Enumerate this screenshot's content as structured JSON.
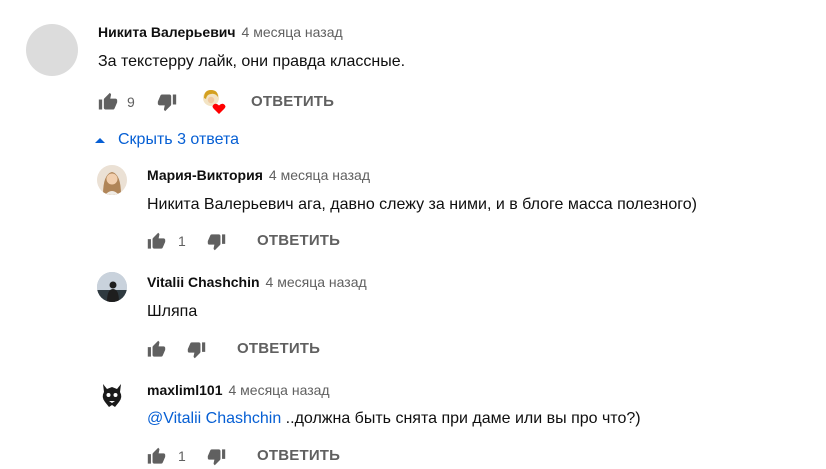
{
  "comments": {
    "main": {
      "author": "Никита Валерьевич",
      "time": "4 месяца назад",
      "text": "За текстерру лайк, они правда классные.",
      "likes": "9",
      "reply_label": "ОТВЕТИТЬ"
    },
    "toggle_label": "Скрыть 3 ответа",
    "replies": [
      {
        "author": "Мария-Виктория",
        "time": "4 месяца назад",
        "text": "Никита Валерьевич ага, давно слежу за ними, и в блоге масса полезного)",
        "likes": "1",
        "reply_label": "ОТВЕТИТЬ"
      },
      {
        "author": "Vitalii Chashchin",
        "time": "4 месяца назад",
        "text": "Шляпа",
        "likes": "",
        "reply_label": "ОТВЕТИТЬ"
      },
      {
        "author": "maxliml101",
        "time": "4 месяца назад",
        "mention": "@Vitalii Chashchin",
        "text": " ..должна быть снята при даме или вы про что?)",
        "likes": "1",
        "reply_label": "ОТВЕТИТЬ"
      }
    ]
  },
  "colors": {
    "link": "#065fd4",
    "secondary_text": "#606060",
    "heart": "#ff0000"
  },
  "icons": [
    "thumb-up-icon",
    "thumb-down-icon",
    "creator-heart-icon",
    "collapse-arrow-icon"
  ]
}
